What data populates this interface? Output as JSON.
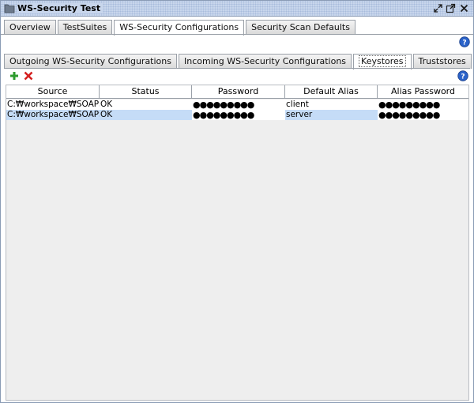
{
  "window": {
    "title": "WS-Security Test",
    "icons": [
      "folder-icon",
      "restore-icon",
      "detach-icon",
      "close-icon"
    ]
  },
  "outer_tabs": [
    {
      "label": "Overview",
      "active": false
    },
    {
      "label": "TestSuites",
      "active": false
    },
    {
      "label": "WS-Security Configurations",
      "active": true
    },
    {
      "label": "Security Scan Defaults",
      "active": false
    }
  ],
  "inner_tabs": [
    {
      "label": "Outgoing WS-Security Configurations",
      "active": false
    },
    {
      "label": "Incoming WS-Security Configurations",
      "active": false
    },
    {
      "label": "Keystores",
      "active": true
    },
    {
      "label": "Truststores",
      "active": false
    }
  ],
  "toolbar": {
    "add_icon": "plus-icon",
    "remove_icon": "x-icon",
    "help_icon": "help-icon"
  },
  "table": {
    "columns": [
      "Source",
      "Status",
      "Password",
      "Default Alias",
      "Alias Password"
    ],
    "rows": [
      {
        "source": "C:₩workspace₩SOAPSe...",
        "status": "OK",
        "password": "●●●●●●●●●",
        "alias": "client",
        "alias_password": "●●●●●●●●●"
      },
      {
        "source": "C:₩workspace₩SOAPSe...",
        "status": "OK",
        "password": "●●●●●●●●●",
        "alias": "server",
        "alias_password": "●●●●●●●●●"
      }
    ],
    "selected_row": 1
  },
  "colors": {
    "titlebar": "#c8d6ec",
    "selection": "#c5dcf7",
    "table_bg": "#eeeeee"
  }
}
